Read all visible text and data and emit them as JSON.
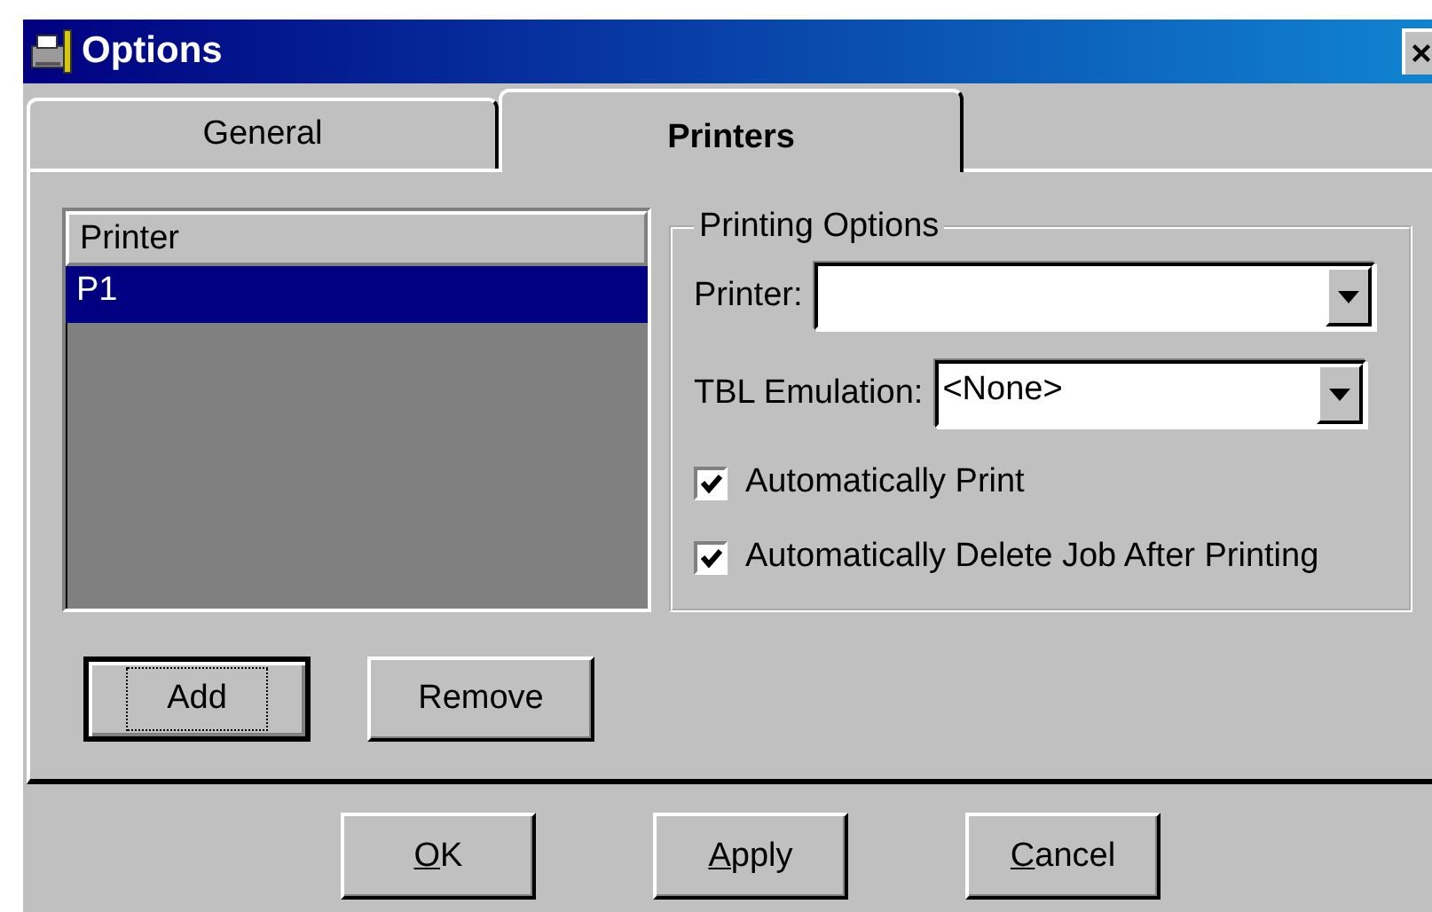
{
  "window": {
    "title": "Options"
  },
  "tabs": [
    {
      "label": "General",
      "selected": false
    },
    {
      "label": "Printers",
      "selected": true
    }
  ],
  "printer_list": {
    "header": "Printer",
    "rows": [
      {
        "label": "P1",
        "selected": true
      }
    ]
  },
  "printing_options": {
    "title": "Printing Options",
    "fields": [
      {
        "label": "Printer:"
      },
      {
        "label": "TBL Emulation:",
        "value": "<None>"
      }
    ],
    "checkboxes": [
      {
        "label": "Automatically Print",
        "checked": true
      },
      {
        "label": "Automatically Delete Job After Printing",
        "checked": true
      }
    ]
  },
  "list_buttons": [
    {
      "label": "Add",
      "focused": true
    },
    {
      "label": "Remove",
      "focused": false
    }
  ],
  "dialog_buttons": [
    "OK",
    "Apply",
    "Cancel"
  ]
}
